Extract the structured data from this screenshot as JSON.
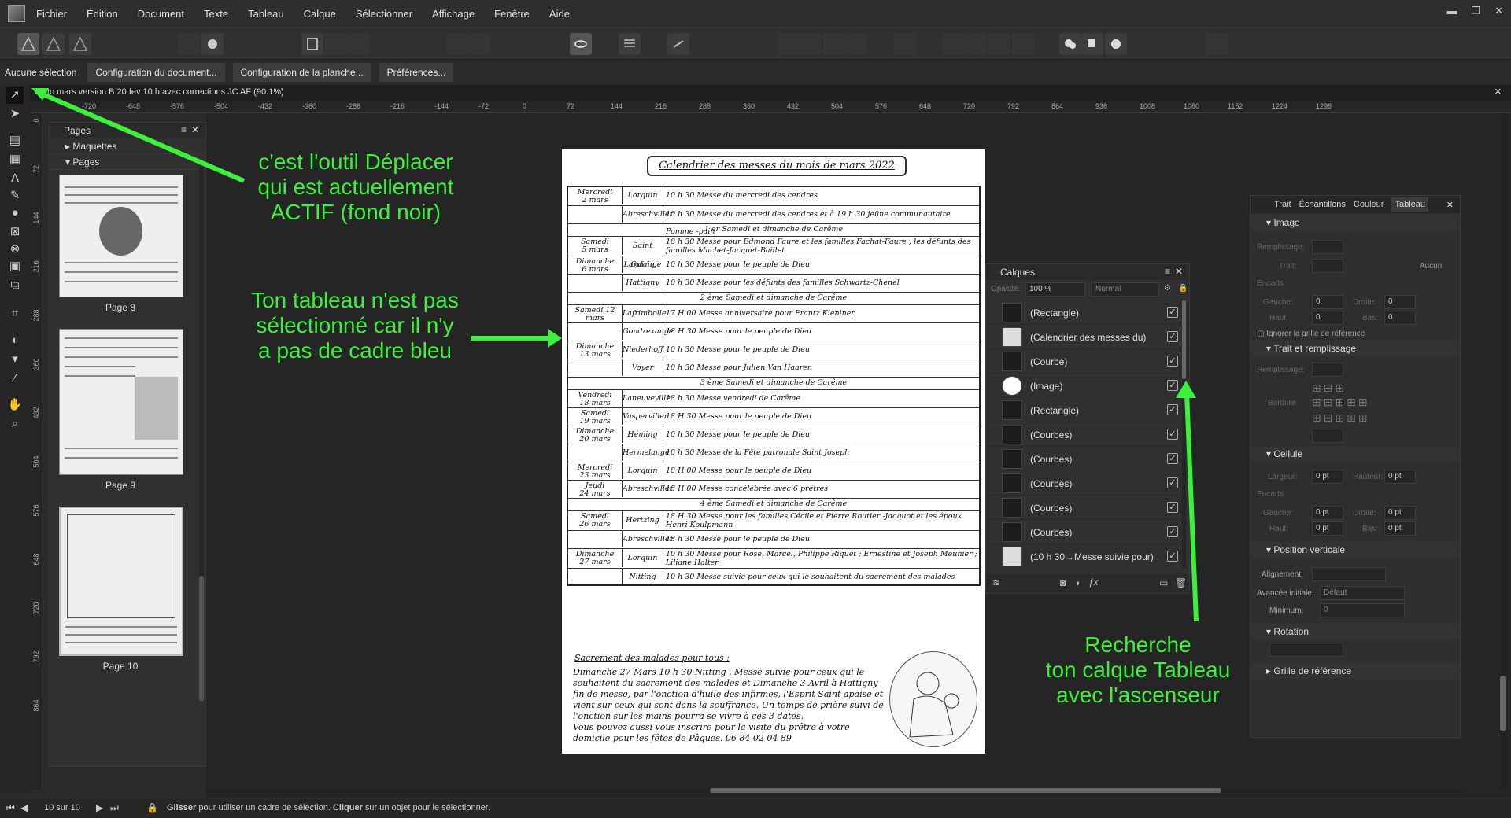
{
  "menubar": {
    "items": [
      "Fichier",
      "Édition",
      "Document",
      "Texte",
      "Tableau",
      "Calque",
      "Sélectionner",
      "Affichage",
      "Fenêtre",
      "Aide"
    ]
  },
  "contextbar": {
    "selection": "Aucune sélection",
    "buttons": [
      "Configuration du document...",
      "Configuration de la planche...",
      "Préférences..."
    ]
  },
  "doctab": {
    "title": "Edito mars version B 20  fev 10 h avec corrections JC AF (90.1%)"
  },
  "rulers": {
    "h": [
      "-720",
      "-648",
      "-576",
      "-504",
      "-432",
      "-360",
      "-288",
      "-216",
      "-144",
      "-72",
      "0",
      "72",
      "144",
      "216",
      "288",
      "360",
      "432",
      "504",
      "576",
      "648",
      "720",
      "792",
      "864",
      "936",
      "1008",
      "1080",
      "1152",
      "1224",
      "1296"
    ],
    "v": [
      "0",
      "72",
      "144",
      "216",
      "288",
      "360",
      "432",
      "504",
      "576",
      "648",
      "720",
      "792",
      "864"
    ]
  },
  "pages_panel": {
    "title": "Pages",
    "rows": [
      "Maquettes",
      "Pages"
    ],
    "thumbnails": [
      "Page 8",
      "Page 9",
      "Page 10"
    ]
  },
  "document": {
    "title": "Calendrier des messes du mois de mars 2022",
    "rows": [
      {
        "type": "row",
        "day": "Mercredi\n2  mars",
        "place": "Lorquin",
        "mass": "10 h 30 Messe du mercredi des cendres"
      },
      {
        "type": "row",
        "day": "",
        "place": "Abreschviller",
        "mass": "10 h 30 Messe du mercredi des cendres et à 19 h 30 jeûne communautaire Pomme -pain"
      },
      {
        "type": "sec",
        "text": "1 er  Samedi et dimanche de Carême"
      },
      {
        "type": "row",
        "day": "Samedi\n5 mars",
        "place": "Saint Quirin",
        "mass": "18 h 30 Messe pour Edmond Faure et les familles Fachat-Faure ;  les défunts des familles Machet-Jacquet-Baillet"
      },
      {
        "type": "row",
        "day": "Dimanche\n6 mars",
        "place": "Landange",
        "mass": "10 h 30  Messe pour le peuple de Dieu"
      },
      {
        "type": "row",
        "day": "",
        "place": "Hattigny",
        "mass": "10 h 30  Messe pour les défunts des familles Schwartz-Chenel"
      },
      {
        "type": "sec",
        "text": "2 ème Samedi et dimanche de Carême"
      },
      {
        "type": "row",
        "day": "Samedi 12\nmars",
        "place": "Lafrimbolle",
        "mass": "17 H 00 Messe anniversaire pour Frantz Kieniner"
      },
      {
        "type": "row",
        "day": "",
        "place": "Gondrexange",
        "mass": "18 H 30 Messe pour le peuple de Dieu"
      },
      {
        "type": "row",
        "day": "Dimanche\n13 mars",
        "place": "Niederhoff",
        "mass": "10 h 30  Messe pour le peuple de Dieu"
      },
      {
        "type": "row",
        "day": "",
        "place": "Voyer",
        "mass": "10 h 30  Messe pour Julien Van Haaren"
      },
      {
        "type": "sec",
        "text": "3 ème Samedi et dimanche de Carême"
      },
      {
        "type": "row",
        "day": "Vendredi\n18 mars",
        "place": "Laneuveville",
        "mass": "18 h 30 Messe vendredi de Carême"
      },
      {
        "type": "row",
        "day": "Samedi\n19 mars",
        "place": "Vasperviller",
        "mass": "18 H 30 Messe pour le peuple de Dieu"
      },
      {
        "type": "row",
        "day": "Dimanche\n20 mars",
        "place": "Héming",
        "mass": "10 h 30  Messe pour le peuple de Dieu"
      },
      {
        "type": "row",
        "day": "",
        "place": "Hermelange",
        "mass": "10 h 30  Messe de la  Fête patronale  Saint Joseph"
      },
      {
        "type": "row",
        "day": "Mercredi\n23 mars",
        "place": "Lorquin",
        "mass": "18 H 00 Messe pour le peuple de Dieu"
      },
      {
        "type": "row",
        "day": "Jeudi\n24 mars",
        "place": "Abreschviller",
        "mass": "18 H 00 Messe concélébrée avec 6 prêtres"
      },
      {
        "type": "sec",
        "text": "4 ème Samedi et dimanche de Carême"
      },
      {
        "type": "row",
        "day": "Samedi\n26 mars",
        "place": "Hertzing",
        "mass": "18 H 30 Messe pour les familles Cécile et Pierre Routier -Jacquot et les époux Henri Koulpmann"
      },
      {
        "type": "row",
        "day": "",
        "place": "Abreschviller",
        "mass": "18 h 30  Messe  pour le peuple de Dieu"
      },
      {
        "type": "row",
        "day": "Dimanche\n27 mars",
        "place": "Lorquin",
        "mass": "10 h 30  Messe pour Rose, Marcel, Philippe Riquet ; Ernestine et Joseph Meunier ; Liliane Halter"
      },
      {
        "type": "row",
        "day": "",
        "place": "Nitting",
        "mass": "10 h 30  Messe suivie pour ceux qui le souhaitent du sacrement des malades"
      }
    ],
    "malades_title": "Sacrement des malades pour tous :",
    "malades_text": "Dimanche 27 Mars  10 h 30  Nitting , Messe suivie pour ceux qui le souhaitent du sacrement des malades et Dimanche 3 Avril à Hattigny fin de messe, par l'onction d'huile des infirmes, l'Esprit Saint apaise et vient sur ceux qui sont dans la souffrance. Un temps de prière suivi de l'onction sur les mains pourra se vivre à ces 3 dates.\n     Vous pouvez aussi vous inscrire pour la visite du prêtre à votre domicile pour les fêtes de Pâques. 06 84 02 04 89"
  },
  "layers_panel": {
    "title": "Calques",
    "opacity_label": "Opacité:",
    "opacity": "100 %",
    "blend": "Normal",
    "layers": [
      "(Rectangle)",
      "(Calendrier des messes du)",
      "(Courbe)",
      "(Image)",
      "(Rectangle)",
      "(Courbes)",
      "(Courbes)",
      "(Courbes)",
      "(Courbes)",
      "(Courbes)",
      "(10 h 30→Messe suivie pour)"
    ]
  },
  "right_panel": {
    "tabs": [
      "Trait",
      "Échantillons",
      "Couleur",
      "Tableau"
    ],
    "sections": {
      "image": "Image",
      "trait_remplissage": "Trait et remplissage",
      "cellule": "Cellule",
      "position_verticale": "Position verticale",
      "rotation": "Rotation",
      "grille": "Grille de référence"
    },
    "labels": {
      "remplissage": "Remplissage:",
      "trait": "Trait:",
      "aucun": "Aucun",
      "encarts": "Encarts",
      "gauche": "Gauche:",
      "droite": "Droite:",
      "haut": "Haut:",
      "bas": "Bas:",
      "ignorer": "Ignorer la grille de référence",
      "bordure": "Bordure:",
      "largeur": "Largeur:",
      "hauteur": "Hauteur:",
      "alignement": "Alignement:",
      "avancee": "Avancée initiale:",
      "minimum": "Minimum:"
    },
    "values": {
      "zero": "0",
      "zero_pt": "0 pt",
      "defaut": "Défaut"
    }
  },
  "annotations": {
    "tool": "c'est l'outil Déplacer\nqui est actuellement\nACTIF (fond noir)",
    "table": "Ton tableau n'est pas\nsélectionné car il n'y\na pas de cadre bleu",
    "layer": "Recherche\nton calque Tableau\navec l'ascenseur",
    "color": "#3cf03c"
  },
  "status": {
    "page": "10 sur 10",
    "hint_bold1": "Glisser",
    "hint1": " pour utiliser un cadre de sélection. ",
    "hint_bold2": "Cliquer",
    "hint2": " sur un objet pour le sélectionner."
  }
}
